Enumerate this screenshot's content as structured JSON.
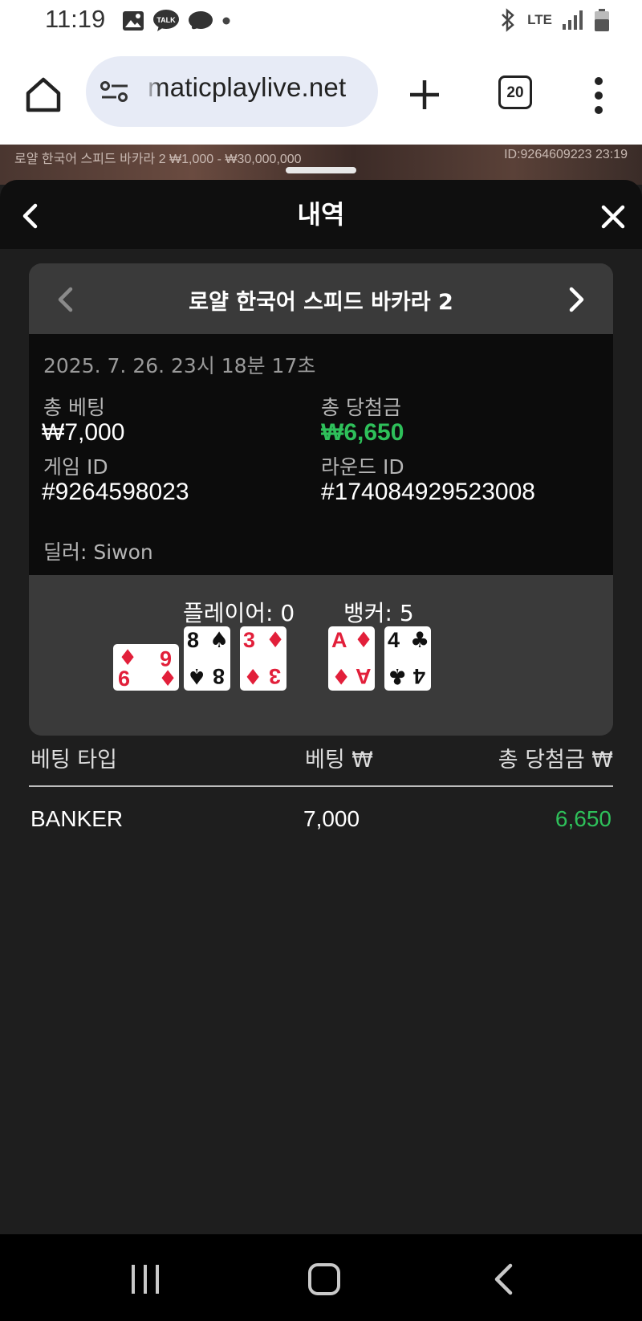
{
  "status_bar": {
    "time": "11:19",
    "network": "LTE",
    "icons": [
      "image-icon",
      "talk-icon",
      "chat-icon",
      "dot-icon",
      "bluetooth-icon",
      "signal-icon",
      "battery-icon"
    ]
  },
  "browser": {
    "url": "maticplaylive.net",
    "tab_count": "20"
  },
  "video_strip": {
    "left_text": "로얄 한국어 스피드 바카라 2  ₩1,000 - ₩30,000,000",
    "right_text": "ID:9264609223  23:19"
  },
  "panel": {
    "title": "내역",
    "game_title": "로얄 한국어 스피드 바카라 2",
    "datetime": "2025. 7. 26. 23시 18분 17초",
    "total_bet_label": "총 베팅",
    "total_bet_value": "₩7,000",
    "total_win_label": "총 당첨금",
    "total_win_value": "₩6,650",
    "game_id_label": "게임 ID",
    "game_id_value": "#9264598023",
    "round_id_label": "라운드 ID",
    "round_id_value": "#174084929523008",
    "dealer": "딜러: Siwon"
  },
  "cards": {
    "player_label": "플레이어: 0",
    "banker_label": "뱅커: 5",
    "player_cards": [
      {
        "rank": "6",
        "suit": "♦",
        "color": "red",
        "sideways": true
      },
      {
        "rank": "8",
        "suit": "♠",
        "color": "black"
      },
      {
        "rank": "3",
        "suit": "♦",
        "color": "red"
      }
    ],
    "banker_cards": [
      {
        "rank": "A",
        "suit": "♦",
        "color": "red"
      },
      {
        "rank": "4",
        "suit": "♣",
        "color": "black"
      }
    ]
  },
  "bet_table": {
    "headers": [
      "베팅 타입",
      "베팅 ₩",
      "총 당첨금 ₩"
    ],
    "rows": [
      {
        "type": "BANKER",
        "bet": "7,000",
        "win": "6,650"
      }
    ]
  },
  "colors": {
    "win_green": "#2ec05a",
    "card_red": "#e21f3a",
    "panel_bg": "#1e1e1e",
    "header_bg": "#0f0f0f"
  }
}
